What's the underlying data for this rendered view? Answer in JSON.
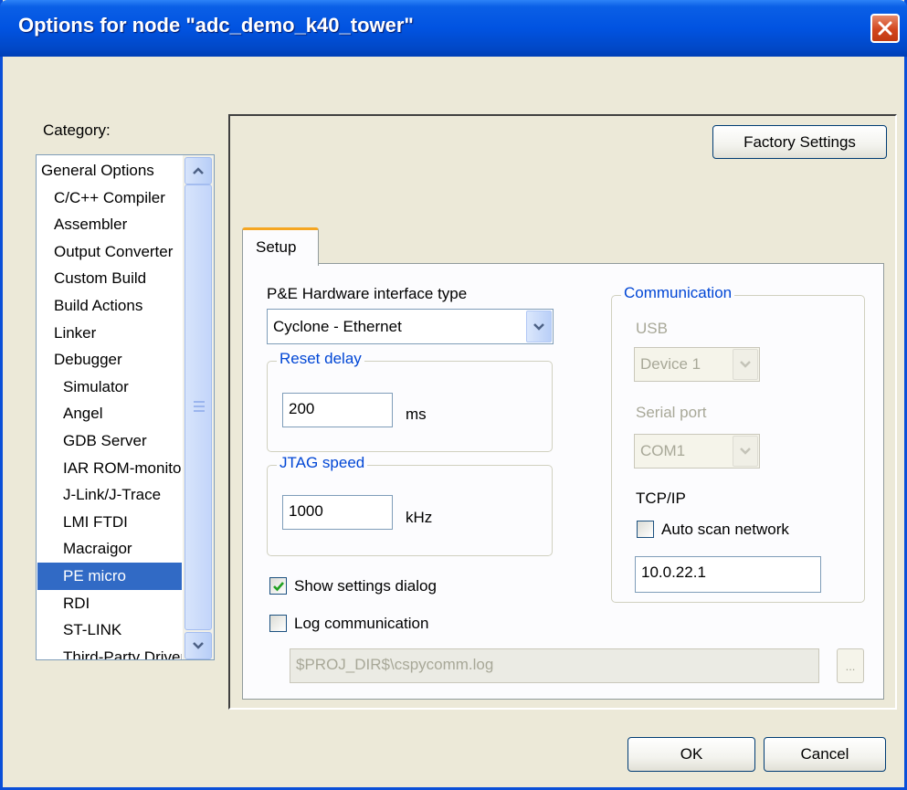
{
  "window": {
    "title": "Options for node \"adc_demo_k40_tower\""
  },
  "category": {
    "label": "Category:",
    "items": [
      {
        "label": "General Options",
        "indent": 0,
        "selected": false
      },
      {
        "label": "C/C++ Compiler",
        "indent": 1,
        "selected": false
      },
      {
        "label": "Assembler",
        "indent": 1,
        "selected": false
      },
      {
        "label": "Output Converter",
        "indent": 1,
        "selected": false
      },
      {
        "label": "Custom Build",
        "indent": 1,
        "selected": false
      },
      {
        "label": "Build Actions",
        "indent": 1,
        "selected": false
      },
      {
        "label": "Linker",
        "indent": 1,
        "selected": false
      },
      {
        "label": "Debugger",
        "indent": 1,
        "selected": false
      },
      {
        "label": "Simulator",
        "indent": 2,
        "selected": false
      },
      {
        "label": "Angel",
        "indent": 2,
        "selected": false
      },
      {
        "label": "GDB Server",
        "indent": 2,
        "selected": false
      },
      {
        "label": "IAR ROM-monitor",
        "indent": 2,
        "selected": false
      },
      {
        "label": "J-Link/J-Trace",
        "indent": 2,
        "selected": false
      },
      {
        "label": "LMI FTDI",
        "indent": 2,
        "selected": false
      },
      {
        "label": "Macraigor",
        "indent": 2,
        "selected": false
      },
      {
        "label": "PE micro",
        "indent": 2,
        "selected": true
      },
      {
        "label": "RDI",
        "indent": 2,
        "selected": false
      },
      {
        "label": "ST-LINK",
        "indent": 2,
        "selected": false
      },
      {
        "label": "Third-Party Driver",
        "indent": 2,
        "selected": false
      }
    ]
  },
  "buttons": {
    "factory_settings": "Factory Settings",
    "ok": "OK",
    "cancel": "Cancel",
    "browse": "..."
  },
  "tabs": [
    {
      "label": "Setup",
      "active": true
    }
  ],
  "setup": {
    "hw_interface_label": "P&E Hardware interface type",
    "hw_interface_value": "Cyclone - Ethernet",
    "reset_delay": {
      "title": "Reset delay",
      "value": "200",
      "unit": "ms"
    },
    "jtag_speed": {
      "title": "JTAG speed",
      "value": "1000",
      "unit": "kHz"
    },
    "show_settings_dialog": {
      "label": "Show settings dialog",
      "checked": true
    },
    "log_communication": {
      "label": "Log communication",
      "checked": false
    },
    "log_path": "$PROJ_DIR$\\cspycomm.log",
    "communication": {
      "title": "Communication",
      "usb_label": "USB",
      "usb_device": "Device 1",
      "serial_label": "Serial port",
      "serial_value": "COM1",
      "tcpip_label": "TCP/IP",
      "auto_scan": {
        "label": "Auto scan network",
        "checked": false
      },
      "ip_address": "10.0.22.1"
    }
  },
  "colors": {
    "title_bar": "#0153e1",
    "selection": "#316ac5",
    "group_title": "#0046d5",
    "tab_highlight": "#f5a622",
    "close_button": "#d2461e"
  }
}
